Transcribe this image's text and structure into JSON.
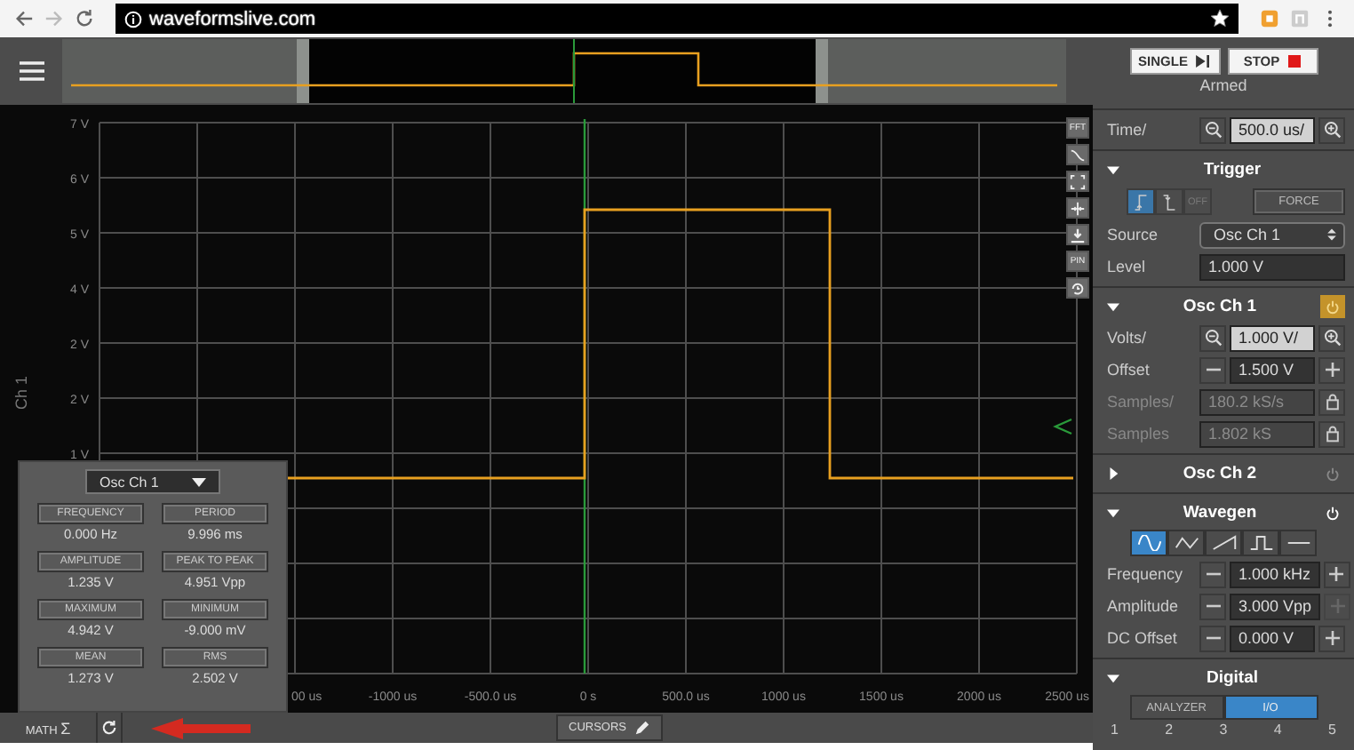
{
  "browser": {
    "url": "waveformslive.com"
  },
  "acquisition": {
    "buttons": [
      {
        "kind": "single",
        "label": "SINGLE"
      },
      {
        "kind": "stop",
        "label": "STOP"
      }
    ],
    "status": "Armed"
  },
  "plot": {
    "channel_label": "Ch 1",
    "y_labels": [
      "7 V",
      "6 V",
      "5 V",
      "4 V",
      "2 V",
      "2 V",
      "1 V"
    ],
    "x_labels": [
      "00 us",
      "-1000 us",
      "-500.0 us",
      "0 s",
      "500.0 us",
      "1000 us",
      "1500 us",
      "2000 us",
      "2500 us"
    ]
  },
  "side_tools": [
    {
      "kind": "text",
      "label": "FFT"
    },
    {
      "kind": "curve"
    },
    {
      "kind": "fit"
    },
    {
      "kind": "split"
    },
    {
      "kind": "download"
    },
    {
      "kind": "text",
      "label": "PIN"
    },
    {
      "kind": "history"
    }
  ],
  "measurements": {
    "source": "Osc Ch 1",
    "items": [
      {
        "label": "FREQUENCY",
        "value": "0.000 Hz"
      },
      {
        "label": "PERIOD",
        "value": "9.996 ms"
      },
      {
        "label": "AMPLITUDE",
        "value": "1.235 V"
      },
      {
        "label": "PEAK TO PEAK",
        "value": "4.951 Vpp"
      },
      {
        "label": "MAXIMUM",
        "value": "4.942 V"
      },
      {
        "label": "MINIMUM",
        "value": "-9.000 mV"
      },
      {
        "label": "MEAN",
        "value": "1.273 V"
      },
      {
        "label": "RMS",
        "value": "2.502 V"
      }
    ]
  },
  "bottom_bar": {
    "math_label": "MATH",
    "math_symbol": "Σ",
    "cursors_label": "CURSORS"
  },
  "time": {
    "label": "Time/",
    "value": "500.0 us/"
  },
  "sections": [
    {
      "kind": "trigger",
      "title": "Trigger",
      "expanded": true,
      "edges": [
        {
          "kind": "rising",
          "selected": true
        },
        {
          "kind": "falling",
          "selected": false
        },
        {
          "kind": "off",
          "label": "OFF",
          "selected": false
        }
      ],
      "force": "FORCE",
      "rows": [
        {
          "kind": "select",
          "label": "Source",
          "value": "Osc Ch 1",
          "disabled": false
        },
        {
          "kind": "plain",
          "label": "Level",
          "value": "1.000 V",
          "disabled": false
        }
      ]
    },
    {
      "kind": "channel",
      "title": "Osc Ch 1",
      "expanded": true,
      "power": true,
      "rows": [
        {
          "kind": "zoom",
          "label": "Volts/",
          "value": "1.000 V/",
          "disabled": false
        },
        {
          "kind": "stepper",
          "label": "Offset",
          "value": "1.500 V",
          "disabled": false,
          "plus_disabled": false
        },
        {
          "kind": "locked",
          "label": "Samples/",
          "value": "180.2 kS/s",
          "disabled": true
        },
        {
          "kind": "locked",
          "label": "Samples",
          "value": "1.802 kS",
          "disabled": true
        }
      ]
    },
    {
      "kind": "channel",
      "title": "Osc Ch 2",
      "expanded": false,
      "power": false
    },
    {
      "kind": "wavegen",
      "title": "Wavegen",
      "expanded": true,
      "power": true,
      "waves": [
        {
          "kind": "sine",
          "selected": true
        },
        {
          "kind": "triangle",
          "selected": false
        },
        {
          "kind": "sawtooth",
          "selected": false
        },
        {
          "kind": "square",
          "selected": false
        },
        {
          "kind": "dc",
          "selected": false
        }
      ],
      "rows": [
        {
          "kind": "stepper",
          "label": "Frequency",
          "value": "1.000 kHz",
          "disabled": false,
          "plus_disabled": false
        },
        {
          "kind": "stepper",
          "label": "Amplitude",
          "value": "3.000 Vpp",
          "disabled": false,
          "plus_disabled": true
        },
        {
          "kind": "stepper",
          "label": "DC Offset",
          "value": "0.000 V",
          "disabled": false,
          "plus_disabled": false
        }
      ]
    },
    {
      "kind": "digital",
      "title": "Digital",
      "expanded": true,
      "modes": [
        {
          "label": "ANALYZER",
          "selected": false
        },
        {
          "label": "I/O",
          "selected": true
        }
      ],
      "pins": [
        "1",
        "2",
        "3",
        "4",
        "5"
      ]
    }
  ]
}
